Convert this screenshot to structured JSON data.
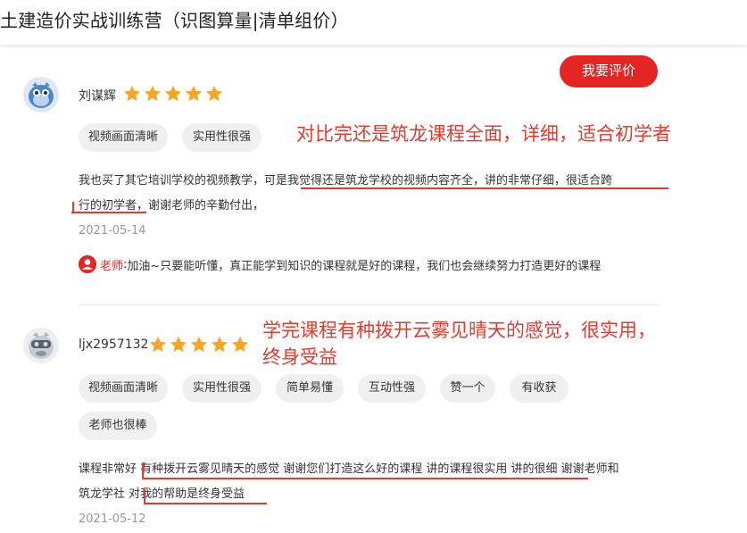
{
  "course": {
    "title": "土建造价实战训练营（识图算量|清单组价）"
  },
  "actions": {
    "review_button": "我要评价"
  },
  "reviews": [
    {
      "username": "刘谋辉",
      "rating": 5,
      "tags": [
        "视频画面清晰",
        "实用性很强"
      ],
      "annotation": "对比完还是筑龙课程全面，详细，适合初学者",
      "text_line1": "我也买了其它培训学校的视频教学，可是我觉得还是筑龙学校的视频内容齐全，讲的非常仔细，很适合跨",
      "text_line2": "行的初学者，谢谢老师的辛勤付出，",
      "date": "2021-05-14",
      "reply": {
        "role": "老师",
        "separator": ":",
        "text": "加油~只要能听懂，真正能学到知识的课程就是好的课程，我们也会继续努力打造更好的课程"
      }
    },
    {
      "username": "ljx2957132",
      "rating": 5,
      "tags": [
        "视频画面清晰",
        "实用性很强",
        "简单易懂",
        "互动性强",
        "赞一个",
        "有收获",
        "老师也很棒"
      ],
      "annotation_line1": "学完课程有种拨开云雾见晴天的感觉，很实用，",
      "annotation_line2": "终身受益",
      "text_line1": "课程非常好 有种拨开云雾见晴天的感觉 谢谢您们打造这么好的课程 讲的课程很实用 讲的很细 谢谢老师和",
      "text_line2": "筑龙学社 对我的帮助是终身受益",
      "date": "2021-05-12"
    }
  ],
  "colors": {
    "accent": "#e52424",
    "annotation": "#e33b2e",
    "star": "#f5a623",
    "tag_bg": "#f0f0f0"
  }
}
